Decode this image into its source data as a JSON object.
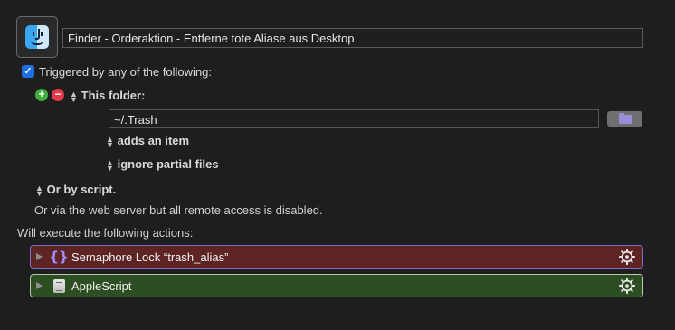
{
  "macro": {
    "name": "Finder - Orderaktion - Entferne tote Aliase aus Desktop",
    "icon": "finder-icon"
  },
  "trigger": {
    "enabled": true,
    "checkbox_label": "Triggered by any of the following:",
    "type_label": "This folder:",
    "folder_path": "~/.Trash",
    "event": "adds an item",
    "option": "ignore partial files"
  },
  "script_trigger_label": "Or by script.",
  "web_server_note": "Or via the web server but all remote access is disabled.",
  "actions_heading": "Will execute the following actions:",
  "actions": [
    {
      "title": "Semaphore Lock “trash_alias”",
      "icon": "braces-icon",
      "color": "#5e2424"
    },
    {
      "title": "AppleScript",
      "icon": "applescript-icon",
      "color": "#2c4e22"
    }
  ],
  "colors": {
    "background": "#1e1e1e",
    "checkbox": "#1f6fe5",
    "add": "#3fae3f",
    "remove": "#e0394a"
  }
}
